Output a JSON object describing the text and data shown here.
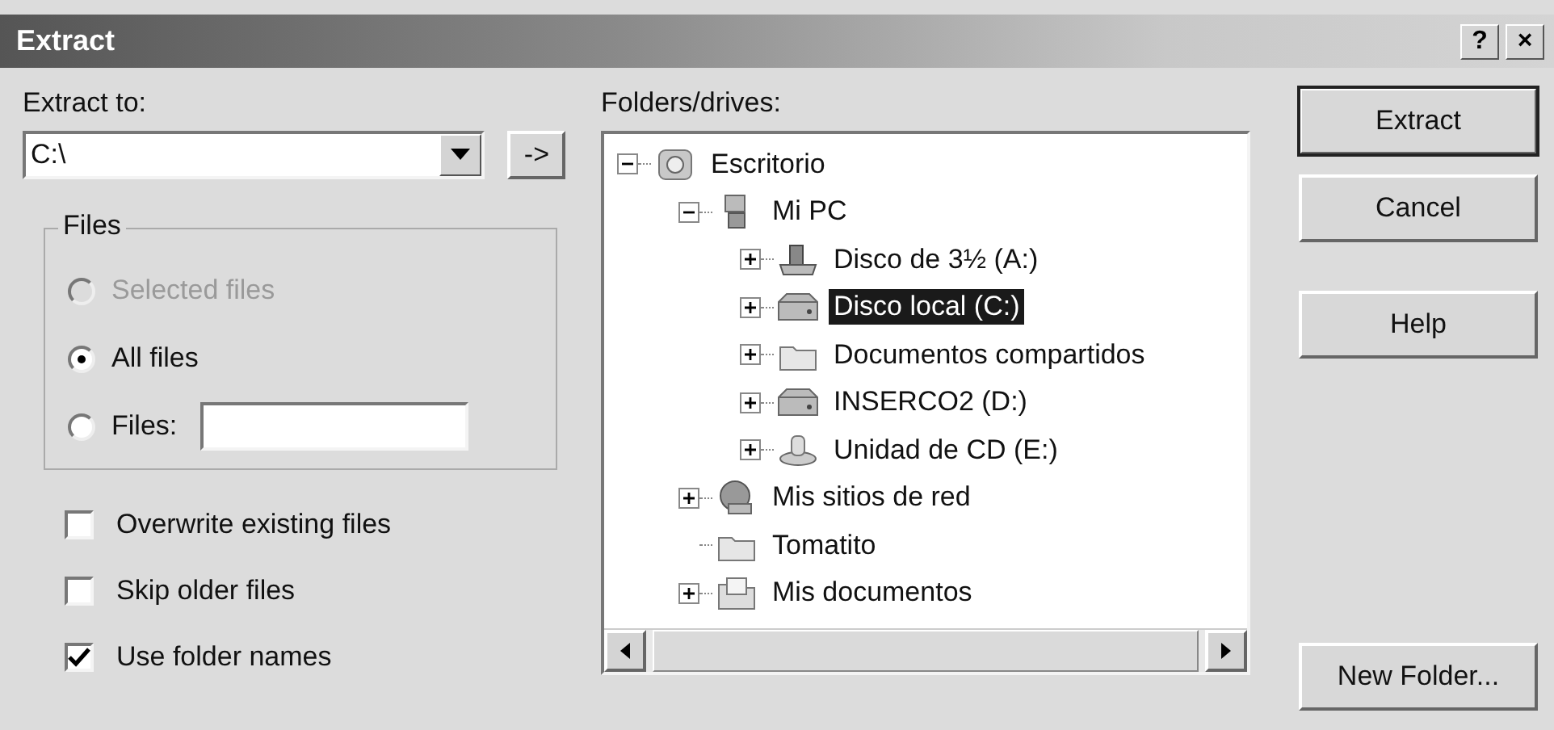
{
  "window": {
    "title": "Extract",
    "help_button": "?",
    "close_button": "×"
  },
  "extract_to": {
    "label": "Extract to:",
    "value": "C:\\",
    "go_button": "->"
  },
  "files_group": {
    "title": "Files",
    "options": [
      {
        "label": "Selected files",
        "kind": "plain",
        "selected": false,
        "disabled": true
      },
      {
        "label": "All files",
        "kind": "plain",
        "selected": true,
        "disabled": false
      },
      {
        "label": "Files:",
        "kind": "field",
        "selected": false,
        "disabled": false
      }
    ]
  },
  "checkboxes": [
    {
      "label": "Overwrite existing files",
      "checked": false
    },
    {
      "label": "Skip older files",
      "checked": false
    },
    {
      "label": "Use folder names",
      "checked": true
    }
  ],
  "folders": {
    "label": "Folders/drives:",
    "tree": [
      {
        "label": "Escritorio",
        "kind": "desktop",
        "expandable": true,
        "expanded": true,
        "selected": false,
        "children": [
          {
            "label": "Mi PC",
            "kind": "computer",
            "expandable": true,
            "expanded": true,
            "selected": false,
            "children": [
              {
                "label": "Disco de 3½ (A:)",
                "kind": "floppy",
                "expandable": true,
                "expanded": false,
                "selected": false
              },
              {
                "label": "Disco local (C:)",
                "kind": "drive",
                "expandable": true,
                "expanded": false,
                "selected": true
              },
              {
                "label": "Documentos compartidos",
                "kind": "folder",
                "expandable": true,
                "expanded": false,
                "selected": false
              },
              {
                "label": "INSERCO2 (D:)",
                "kind": "drive",
                "expandable": true,
                "expanded": false,
                "selected": false
              },
              {
                "label": "Unidad de CD (E:)",
                "kind": "cdrom",
                "expandable": true,
                "expanded": false,
                "selected": false
              }
            ]
          },
          {
            "label": "Mis sitios de red",
            "kind": "network",
            "expandable": true,
            "expanded": false,
            "selected": false
          },
          {
            "label": "Tomatito",
            "kind": "folder",
            "expandable": false,
            "expanded": false,
            "selected": false
          },
          {
            "label": "Mis documentos",
            "kind": "documents",
            "expandable": true,
            "expanded": false,
            "selected": false
          }
        ]
      }
    ]
  },
  "buttons": [
    {
      "label": "Extract",
      "default": true,
      "kind": "top"
    },
    {
      "label": "Cancel",
      "default": false,
      "kind": "top"
    },
    {
      "label": "Help",
      "default": false,
      "kind": "top"
    },
    {
      "label": "New Folder...",
      "default": false,
      "kind": "bottom"
    }
  ]
}
